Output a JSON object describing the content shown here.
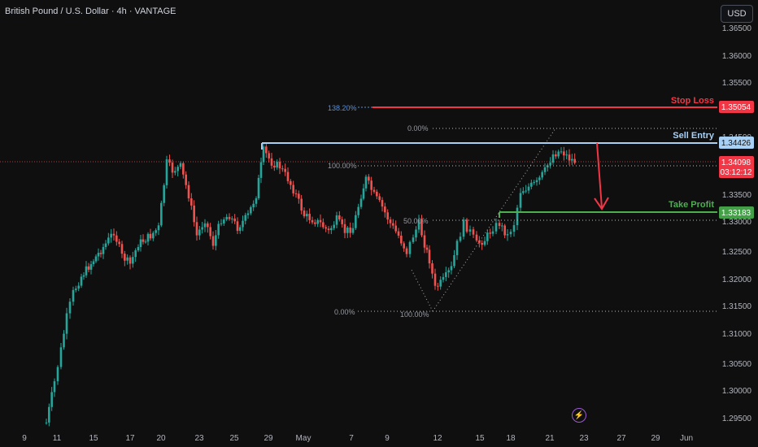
{
  "header": {
    "title": "British Pound / U.S. Dollar · 4h · VANTAGE",
    "currency": "USD"
  },
  "price_axis": {
    "labels": [
      "1.36500",
      "1.36000",
      "1.35500",
      "1.35000",
      "1.34500",
      "1.34000",
      "1.33500",
      "1.33000",
      "1.32500",
      "1.32000",
      "1.31500",
      "1.31000",
      "1.30500",
      "1.30000",
      "1.29500"
    ],
    "tags": {
      "stop_loss": "1.35054",
      "sell_entry": "1.34426",
      "current": "1.34098",
      "countdown": "03:12:12",
      "take_profit": "1.33183"
    }
  },
  "time_axis": [
    "9",
    "11",
    "15",
    "17",
    "20",
    "23",
    "25",
    "29",
    "May",
    "7",
    "9",
    "12",
    "15",
    "18",
    "21",
    "23",
    "27",
    "29",
    "Jun"
  ],
  "annotations": {
    "stop_loss": "Stop Loss",
    "sell_entry": "Sell Entry",
    "take_profit": "Take Profit",
    "fib_138": "138.20%",
    "fib_0_top": "0.00%",
    "fib_100_left": "100.00%",
    "fib_50": "50.00%",
    "fib_0_bottom": "0.00%",
    "fib_100_bottom": "100.00%"
  },
  "colors": {
    "up": "#26a69a",
    "down": "#ef5350",
    "stop": "#f23645",
    "entry": "#a9d0f5",
    "tp": "#4caf50"
  },
  "chart_data": {
    "type": "candlestick",
    "price_range": [
      1.2935,
      1.3665
    ],
    "levels": {
      "stop_loss": 1.35054,
      "sell_entry": 1.34426,
      "current": 1.34098,
      "take_profit": 1.33183
    }
  }
}
